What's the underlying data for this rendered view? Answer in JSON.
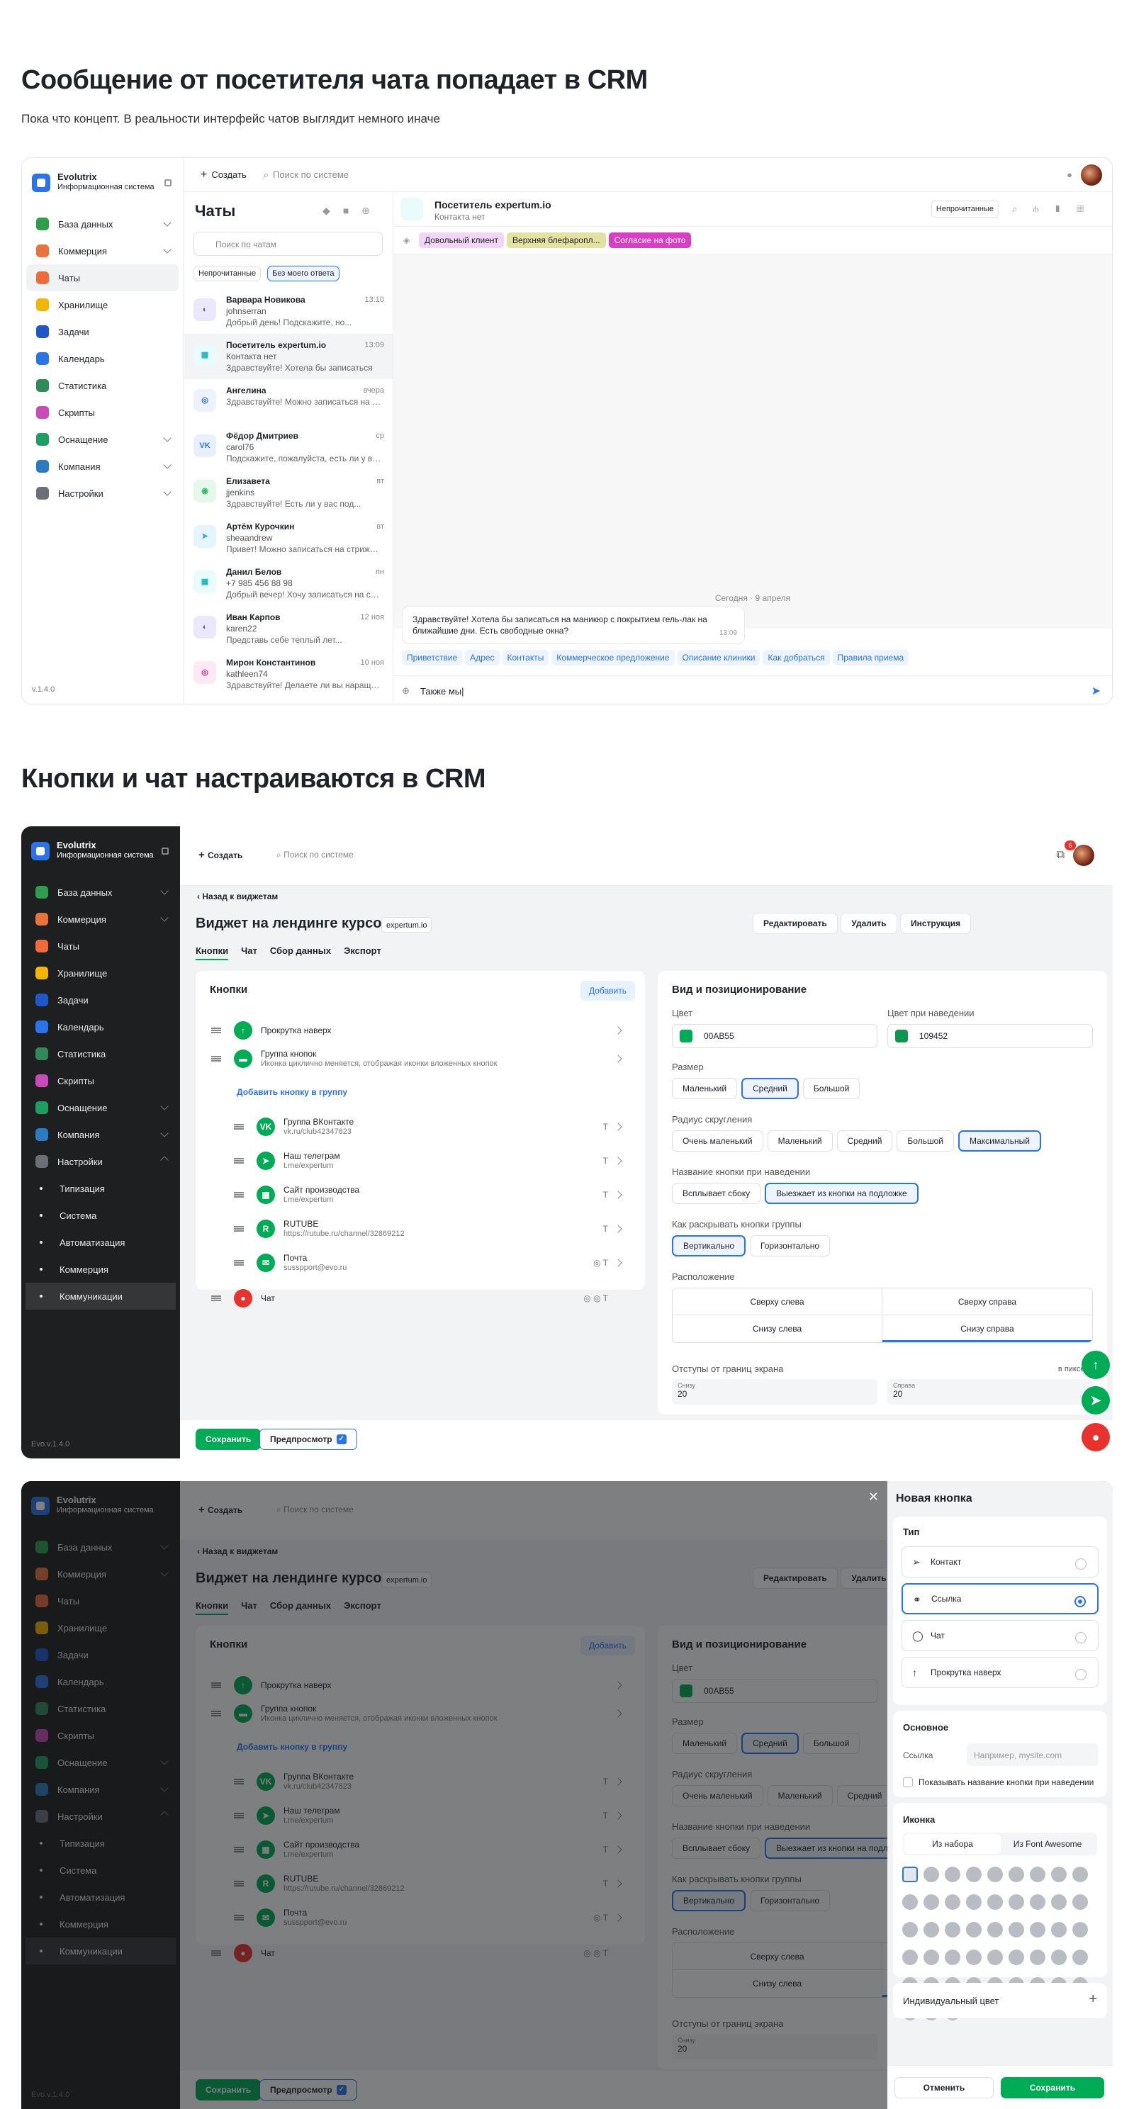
{
  "section1": {
    "title": "Сообщение от посетителя чата попадает в CRM",
    "subtitle": "Пока что концепт. В реальности интерфейс чатов выглядит немного иначе"
  },
  "section2": {
    "title": "Кнопки и чат настраиваются в CRM"
  },
  "app": {
    "name": "Evolutrix",
    "desc": "Информационная система",
    "version": "v.1.4.0",
    "version_dark": "Evo.v.1.4.0",
    "create": "Создать",
    "search": "Поиск по системе",
    "badge": "6"
  },
  "nav": [
    "База данных",
    "Коммерция",
    "Чаты",
    "Хранилище",
    "Задачи",
    "Календарь",
    "Статистика",
    "Скрипты",
    "Оснащение",
    "Компания",
    "Настройки"
  ],
  "subnav": [
    "Типизация",
    "Система",
    "Автоматизация",
    "Коммерция",
    "Коммуникации"
  ],
  "chats": {
    "title": "Чаты",
    "search": "Поиск по чатам",
    "filter_unread": "Непрочитанные",
    "filter_noreply": "Без моего ответа",
    "list": [
      {
        "name": "Варвара Новикова",
        "sub": "johnserran",
        "msg": "Добрый день! Подскажите, но...",
        "time": "13:10"
      },
      {
        "name": "Посетитель expertum.io",
        "sub": "Контакта нет",
        "msg": "Здравствуйте! Хотела бы записаться",
        "time": "13:09"
      },
      {
        "name": "Ангелина",
        "sub": "",
        "msg": "Здравствуйте! Можно записаться на м...",
        "time": "вчера"
      },
      {
        "name": "Фёдор Дмитриев",
        "sub": "carol76",
        "msg": "Подскажите, пожалуйста, есть ли у вас...",
        "time": "ср"
      },
      {
        "name": "Елизавета",
        "sub": "jjenkins",
        "msg": "Здравствуйте! Есть ли у вас под...",
        "time": "вт"
      },
      {
        "name": "Артём Курочкин",
        "sub": "sheaandrew",
        "msg": "Привет! Можно записаться на стрижку...",
        "time": "вт"
      },
      {
        "name": "Данил Белов",
        "sub": "+7 985 456 88 98",
        "msg": "Добрый вечер! Хочу записаться на сеа...",
        "time": "пн"
      },
      {
        "name": "Иван Карпов",
        "sub": "karen22",
        "msg": "Представь себе теплый лет...",
        "time": "12 ноя"
      },
      {
        "name": "Мирон Константинов",
        "sub": "kathleen74",
        "msg": "Здравствуйте! Делаете ли вы наращив...",
        "time": "10 ноя"
      }
    ]
  },
  "conv": {
    "title": "Посетитель expertum.io",
    "sub": "Контакта нет",
    "unread": "Непрочитанные",
    "tags": [
      "Довольный клиент",
      "Верхняя блефаропл...",
      "Согласие на фото"
    ],
    "date": "Сегодня · 9 апреля",
    "message": "Здравствуйте! Хотела бы записаться на маникюр с покрытием гель-лак на ближайшие дни. Есть свободные окна?",
    "msg_time": "13:09",
    "quick": [
      "Приветствие",
      "Адрес",
      "Контакты",
      "Коммерческое предложение",
      "Описание клиники",
      "Как добраться",
      "Правила приема"
    ],
    "input": "Также мы|"
  },
  "widget": {
    "back": "Назад к виджетам",
    "title": "Виджет на лендинге курсов",
    "domain": "expertum.io",
    "edit": "Редактировать",
    "delete": "Удалить",
    "guide": "Инструкция",
    "tabs": [
      "Кнопки",
      "Чат",
      "Сбор данных",
      "Экспорт"
    ],
    "buttons_title": "Кнопки",
    "add": "Добавить",
    "rows": [
      {
        "name": "Прокрутка наверх",
        "sub": ""
      },
      {
        "name": "Группа кнопок",
        "sub": "Иконка циклично меняется, отображая иконки вложенных кнопок"
      },
      {
        "name": "Добавить кнопку в группу",
        "sub": ""
      },
      {
        "name": "Группа ВКонтакте",
        "sub": "vk.ru/club42347623"
      },
      {
        "name": "Наш телеграм",
        "sub": "t.me/expertum"
      },
      {
        "name": "Сайт производства",
        "sub": "t.me/expertum"
      },
      {
        "name": "RUTUBE",
        "sub": "https://rutube.ru/channel/32869212"
      },
      {
        "name": "Почта",
        "sub": "susspport@evo.ru"
      },
      {
        "name": "Чат",
        "sub": ""
      }
    ],
    "view_title": "Вид и позиционирование",
    "color_lbl": "Цвет",
    "color": "00AB55",
    "hover_lbl": "Цвет при наведении",
    "hover": "109452",
    "size_lbl": "Размер",
    "sizes": [
      "Маленький",
      "Средний",
      "Большой"
    ],
    "radius_lbl": "Радиус скругления",
    "radii": [
      "Очень маленький",
      "Маленький",
      "Средний",
      "Большой",
      "Максимальный"
    ],
    "name_lbl": "Название кнопки при наведении",
    "names": [
      "Всплывает сбоку",
      "Выезжает из кнопки на подложке"
    ],
    "expand_lbl": "Как раскрывать кнопки группы",
    "expands": [
      "Вертикально",
      "Горизонтально"
    ],
    "pos_lbl": "Расположение",
    "pos": [
      "Сверху слева",
      "Сверху справа",
      "Снизу слева",
      "Снизу справа"
    ],
    "offset_lbl": "Отступы от границ экрана",
    "offset_unit": "в пикселях",
    "bottom_lbl": "Снизу",
    "bottom": "20",
    "right_lbl": "Справа",
    "right": "20",
    "save": "Сохранить",
    "preview": "Предпросмотр"
  },
  "modal": {
    "title": "Новая кнопка",
    "type_lbl": "Тип",
    "types": [
      "Контакт",
      "Ссылка",
      "Чат",
      "Прокрутка наверх"
    ],
    "main_lbl": "Основное",
    "link_lbl": "Ссылка",
    "link_ph": "Например, mysite.com",
    "show_name": "Показывать название кнопки при наведении",
    "icon_lbl": "Иконка",
    "icon_tabs": [
      "Из набора",
      "Из Font Awesome"
    ],
    "custom_color": "Индивидуальный цвет",
    "cancel": "Отменить",
    "save": "Сохранить"
  },
  "colors": {
    "green": "#00AB55",
    "blue": "#2a73e8"
  }
}
